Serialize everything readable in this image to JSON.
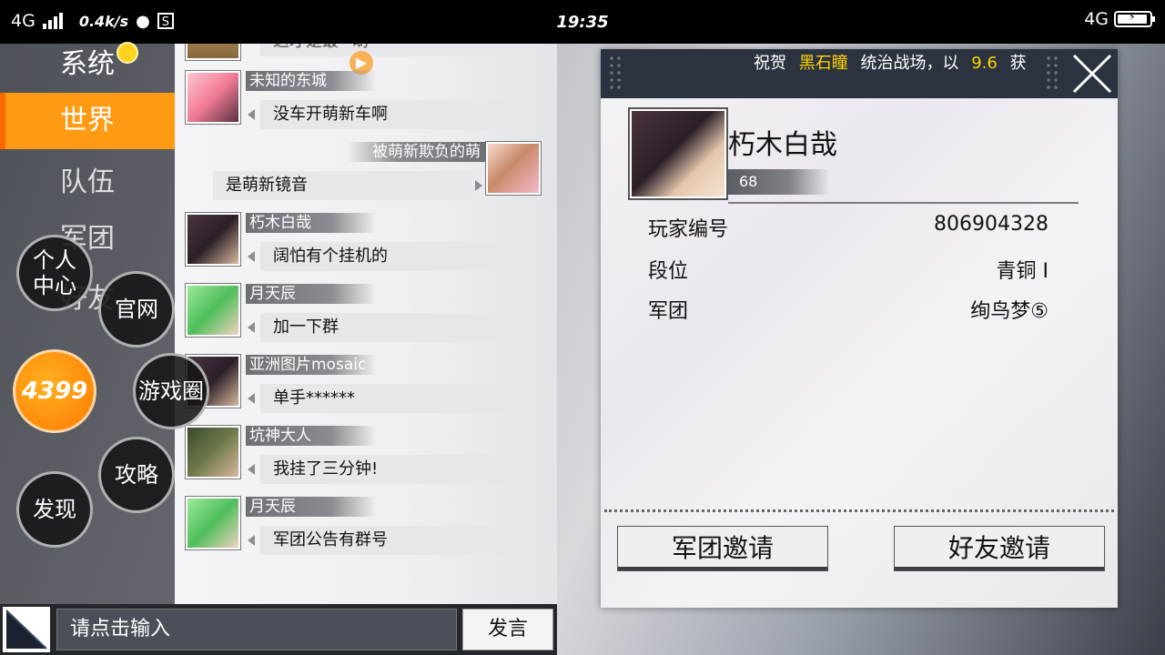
{
  "status_bar": {
    "network_left": "4G",
    "speed": "0.4k/s",
    "time": "19:35",
    "network_right": "4G"
  },
  "nav": {
    "items": [
      {
        "label": "系统"
      },
      {
        "label": "世界"
      },
      {
        "label": "队伍"
      },
      {
        "label": "军团"
      },
      {
        "label": "好友"
      }
    ],
    "active_index": 1
  },
  "floating_menu": {
    "personal_center": "个人\n中心",
    "official_site": "官网",
    "brand": "4399",
    "game_circle": "游戏圈",
    "strategy": "攻略",
    "discover": "发现"
  },
  "chat": {
    "partial_top_message": "这才是最~啲",
    "messages": [
      {
        "user": "未知的东城",
        "text": "没车开萌新车啊",
        "side": "left",
        "avatar": "pink-hair-avatar"
      },
      {
        "user": "被萌新欺负的萌",
        "text": "是萌新镜音",
        "side": "right",
        "avatar": "brown-hair-avatar"
      },
      {
        "user": "朽木白哉",
        "text": "阔怕有个挂机的",
        "side": "left",
        "avatar": "dark-hair-avatar"
      },
      {
        "user": "月天辰",
        "text": "加一下群",
        "side": "left",
        "avatar": "green-hair-avatar"
      },
      {
        "user": "亚洲图片mosaic",
        "text": "单手******",
        "side": "left",
        "avatar": "dark-hair-avatar"
      },
      {
        "user": "坑神大人",
        "text": "我挂了三分钟!",
        "side": "left",
        "avatar": "soldier-avatar"
      },
      {
        "user": "月天辰",
        "text": "军团公告有群号",
        "side": "left",
        "avatar": "green-hair-avatar"
      }
    ]
  },
  "input_bar": {
    "placeholder": "请点击输入",
    "send_label": "发言"
  },
  "profile": {
    "ticker": {
      "prefix": "祝贺",
      "highlight_name": "黑石瞳",
      "middle": "统治战场，以",
      "highlight_value": "9.6",
      "suffix": "获"
    },
    "name": "朽木白哉",
    "level": "68",
    "fields": [
      {
        "label": "玩家编号",
        "value": "806904328"
      },
      {
        "label": "段位",
        "value": "青铜 I"
      },
      {
        "label": "军团",
        "value": "绚鸟梦⑤"
      }
    ],
    "guild_invite": "军团邀请",
    "friend_invite": "好友邀请"
  },
  "colors": {
    "accent_orange": "#ff9a12",
    "ticker_highlight": "#ffd400",
    "panel_header": "#2c3340"
  }
}
